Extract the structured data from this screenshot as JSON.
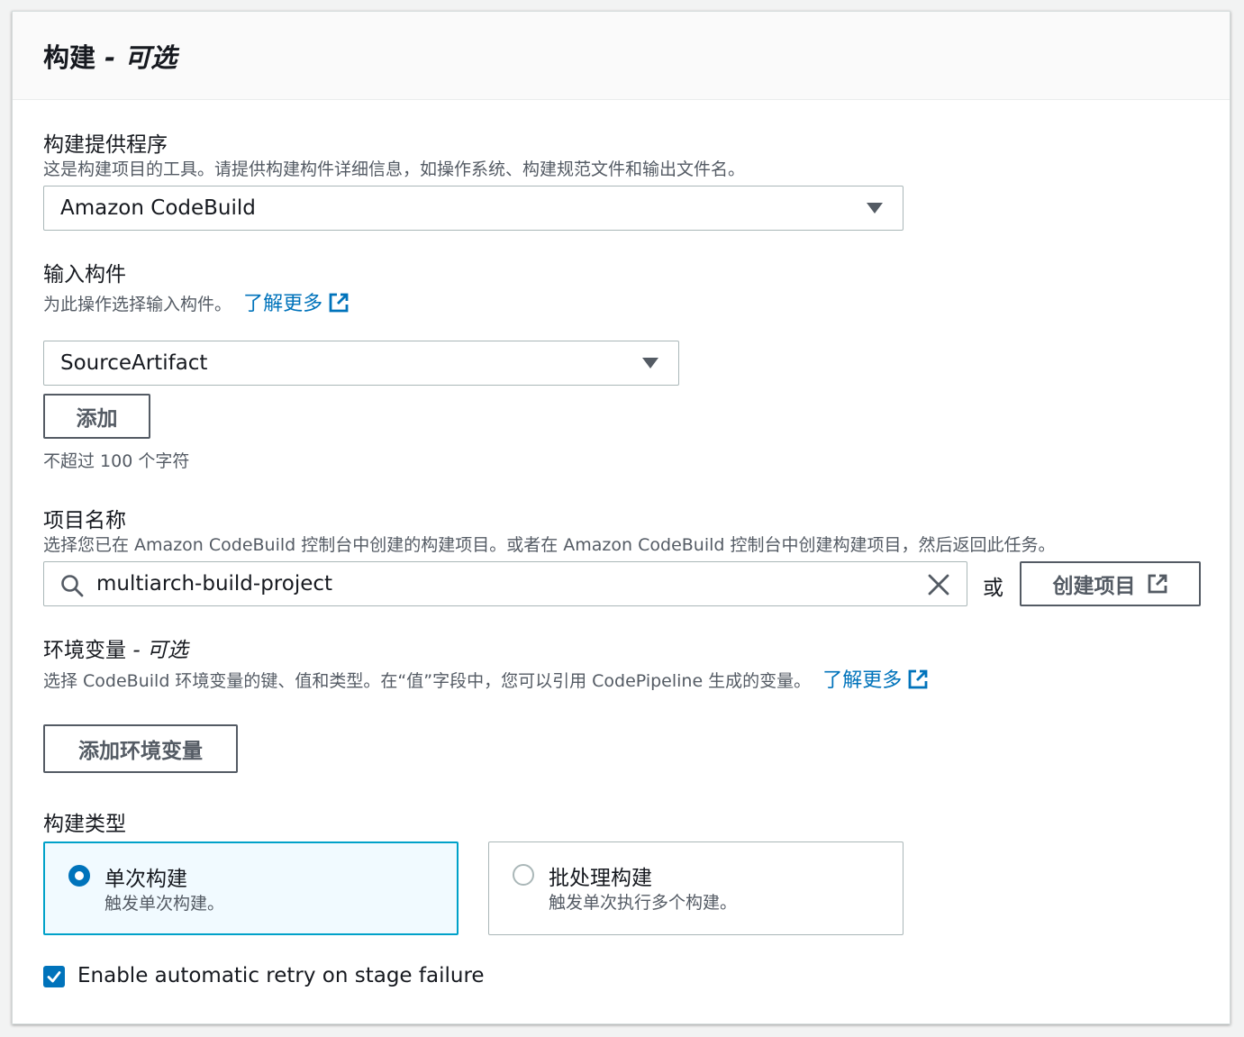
{
  "section": {
    "title": "构建",
    "title_optional": "- 可选"
  },
  "build_provider": {
    "label": "构建提供程序",
    "description": "这是构建项目的工具。请提供构建构件详细信息，如操作系统、构建规范文件和输出文件名。",
    "selected": "Amazon CodeBuild"
  },
  "input_artifacts": {
    "label": "输入构件",
    "description": "为此操作选择输入构件。",
    "learn_more": "了解更多",
    "selected": "SourceArtifact",
    "add_button": "添加",
    "hint": "不超过 100 个字符"
  },
  "project_name": {
    "label": "项目名称",
    "description": "选择您已在 Amazon CodeBuild 控制台中创建的构建项目。或者在 Amazon CodeBuild 控制台中创建构建项目，然后返回此任务。",
    "value": "multiarch-build-project",
    "or_text": "或",
    "create_button": "创建项目"
  },
  "env_vars": {
    "label": "环境变量",
    "label_optional": "- 可选",
    "description": "选择 CodeBuild 环境变量的键、值和类型。在“值”字段中，您可以引用 CodePipeline 生成的变量。",
    "learn_more": "了解更多",
    "add_button": "添加环境变量"
  },
  "build_type": {
    "label": "构建类型",
    "options": [
      {
        "label": "单次构建",
        "description": "触发单次构建。",
        "selected": true
      },
      {
        "label": "批处理构建",
        "description": "触发单次执行多个构建。",
        "selected": false
      }
    ]
  },
  "retry": {
    "label": "Enable automatic retry on stage failure",
    "checked": true
  },
  "colors": {
    "link": "#0073bb",
    "selected_border": "#00a1c9",
    "selected_bg": "#f1faff"
  }
}
